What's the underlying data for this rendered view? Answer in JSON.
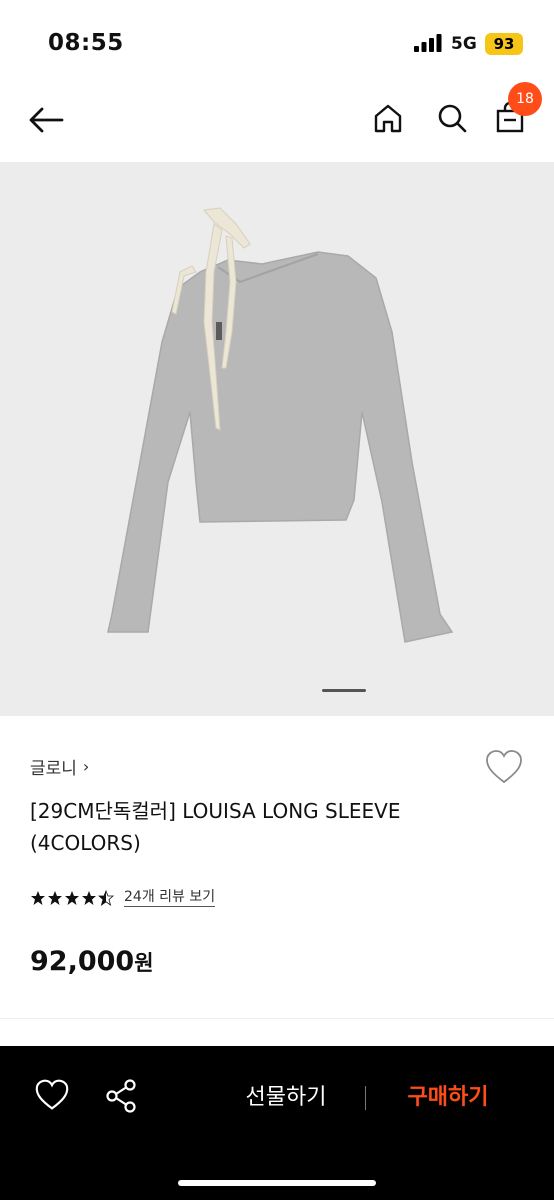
{
  "status_bar": {
    "time": "08:55",
    "network": "5G",
    "battery": "93"
  },
  "nav": {
    "cart_count": "18"
  },
  "product": {
    "brand": "글로니",
    "title": "[29CM단독컬러] LOUISA LONG SLEEVE (4COLORS)",
    "rating_value": 4.5,
    "review_link": "24개 리뷰 보기",
    "price": "92,000",
    "currency": "원",
    "image": {
      "description_icon": "sweater-image",
      "slide_index": 1
    }
  },
  "bottom_bar": {
    "gift_label": "선물하기",
    "buy_label": "구매하기"
  },
  "colors": {
    "accent": "#ff4d1a",
    "battery": "#f5c518",
    "bottom_bg": "#000000"
  }
}
